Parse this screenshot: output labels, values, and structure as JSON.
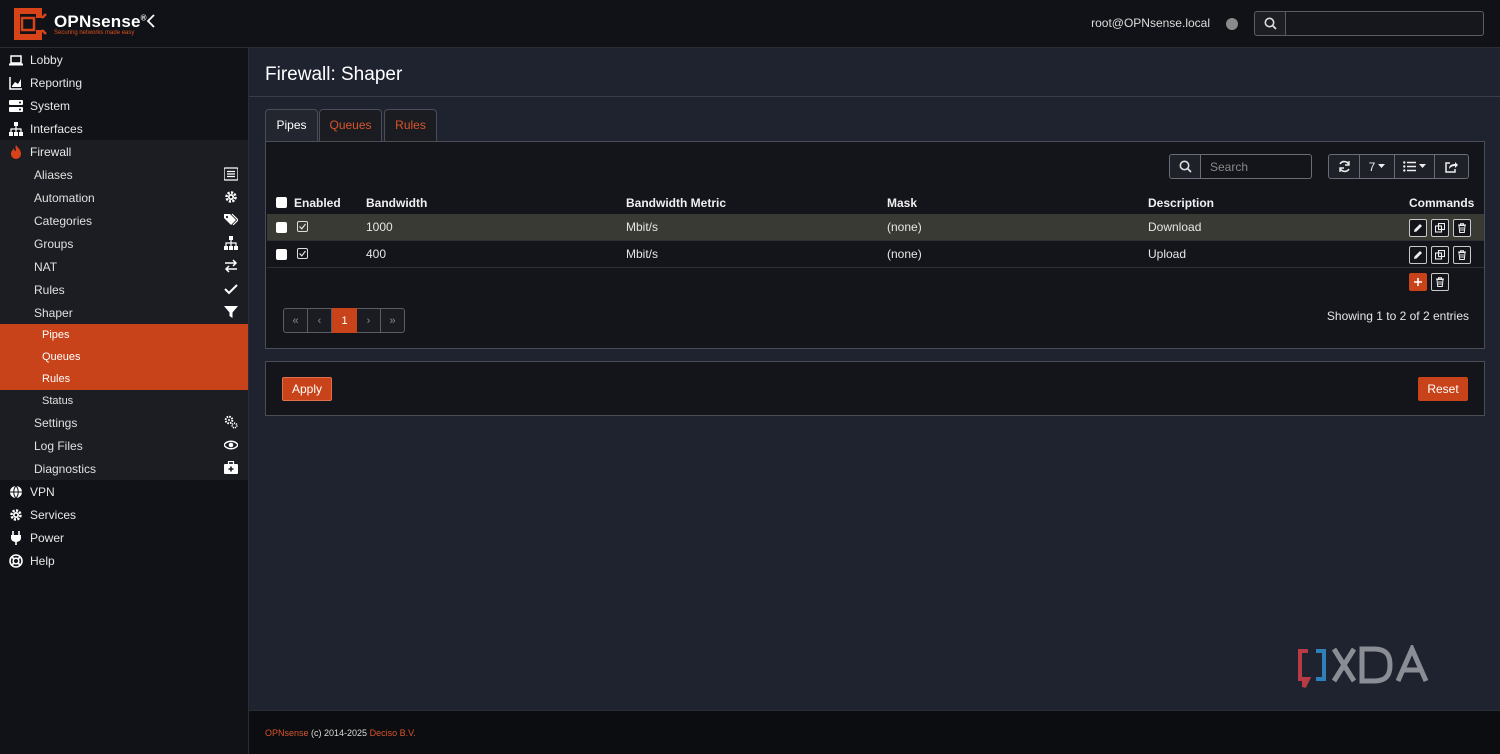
{
  "header": {
    "brand": "OPNsense",
    "brand_mark": "®",
    "tagline": "Securing networks made easy",
    "user": "root@OPNsense.local"
  },
  "sidebar": {
    "top_items": [
      {
        "label": "Lobby",
        "icon": "laptop-icon"
      },
      {
        "label": "Reporting",
        "icon": "chart-icon"
      },
      {
        "label": "System",
        "icon": "server-icon"
      },
      {
        "label": "Interfaces",
        "icon": "sitemap-icon"
      },
      {
        "label": "Firewall",
        "icon": "fire-icon"
      }
    ],
    "firewall_items": [
      {
        "label": "Aliases",
        "icon": "list-icon"
      },
      {
        "label": "Automation",
        "icon": "gear-icon"
      },
      {
        "label": "Categories",
        "icon": "tags-icon"
      },
      {
        "label": "Groups",
        "icon": "sitemap-icon"
      },
      {
        "label": "NAT",
        "icon": "exchange-icon"
      },
      {
        "label": "Rules",
        "icon": "check-icon"
      },
      {
        "label": "Shaper",
        "icon": "filter-icon"
      }
    ],
    "shaper_items": [
      {
        "label": "Pipes",
        "active": true
      },
      {
        "label": "Queues",
        "active": true
      },
      {
        "label": "Rules",
        "active": true
      },
      {
        "label": "Status",
        "active": false
      }
    ],
    "more_firewall_items": [
      {
        "label": "Settings",
        "icon": "gears-icon"
      },
      {
        "label": "Log Files",
        "icon": "eye-icon"
      },
      {
        "label": "Diagnostics",
        "icon": "medkit-icon"
      }
    ],
    "bottom_items": [
      {
        "label": "VPN",
        "icon": "globe-icon"
      },
      {
        "label": "Services",
        "icon": "gear-icon"
      },
      {
        "label": "Power",
        "icon": "plug-icon"
      },
      {
        "label": "Help",
        "icon": "lifebuoy-icon"
      }
    ]
  },
  "main": {
    "title": "Firewall: Shaper",
    "tabs": [
      {
        "label": "Pipes",
        "active": true
      },
      {
        "label": "Queues",
        "active": false
      },
      {
        "label": "Rules",
        "active": false
      }
    ],
    "search_placeholder": "Search",
    "page_size": "7",
    "columns": [
      "Enabled",
      "Bandwidth",
      "Bandwidth Metric",
      "Mask",
      "Description",
      "Commands"
    ],
    "rows": [
      {
        "enabled": true,
        "bandwidth": "1000",
        "metric": "Mbit/s",
        "mask": "(none)",
        "description": "Download"
      },
      {
        "enabled": true,
        "bandwidth": "400",
        "metric": "Mbit/s",
        "mask": "(none)",
        "description": "Upload"
      }
    ],
    "pager": [
      "«",
      "‹",
      "1",
      "›",
      "»"
    ],
    "entries_text": "Showing 1 to 2 of 2 entries",
    "apply_label": "Apply",
    "reset_label": "Reset"
  },
  "footer": {
    "brand": "OPNsense",
    "copyright": " (c) 2014-2025 ",
    "company": "Deciso B.V."
  },
  "colors": {
    "accent": "#c9431a",
    "background": "#1f2330",
    "sidebar": "#111217"
  }
}
